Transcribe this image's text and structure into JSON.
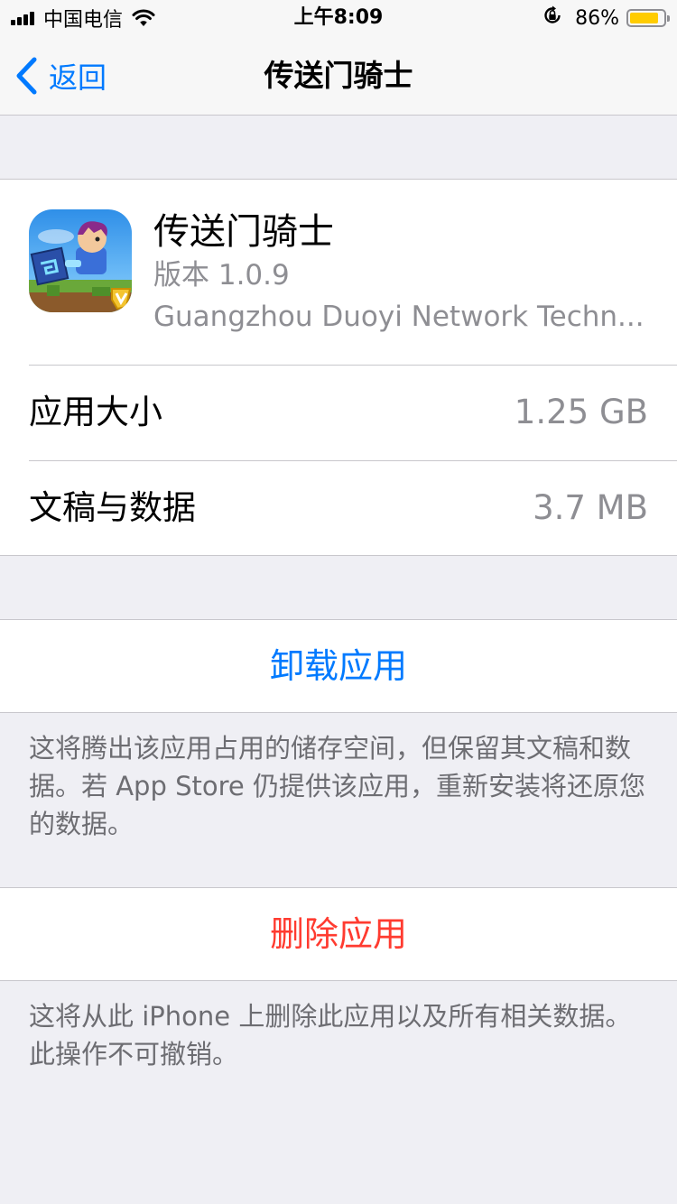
{
  "status_bar": {
    "carrier": "中国电信",
    "time": "上午8:09",
    "battery_percent": "86%",
    "battery_level": 0.86,
    "icons": [
      "signal-icon",
      "wifi-icon",
      "orientation-lock-icon",
      "battery-icon"
    ],
    "battery_color": "#ffcc00"
  },
  "nav": {
    "back_label": "返回",
    "title": "传送门骑士",
    "back_icon": "chevron-left-icon",
    "accent_color": "#007aff"
  },
  "app": {
    "name": "传送门骑士",
    "version": "版本 1.0.9",
    "developer": "Guangzhou Duoyi Network Techn...",
    "icon": "app-icon"
  },
  "storage": {
    "rows": [
      {
        "label": "应用大小",
        "value": "1.25 GB"
      },
      {
        "label": "文稿与数据",
        "value": "3.7 MB"
      }
    ]
  },
  "actions": {
    "offload_label": "卸载应用",
    "offload_note": "这将腾出该应用占用的储存空间，但保留其文稿和数据。若 App Store 仍提供该应用，重新安装将还原您的数据。",
    "delete_label": "删除应用",
    "delete_note": "这将从此 iPhone 上删除此应用以及所有相关数据。此操作不可撤销。",
    "delete_color": "#ff3b30"
  }
}
